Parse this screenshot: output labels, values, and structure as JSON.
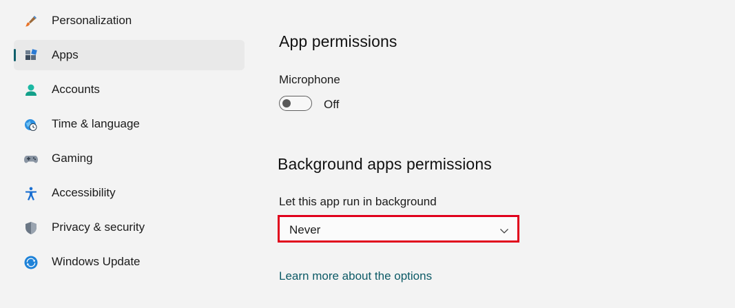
{
  "sidebar": {
    "items": [
      {
        "label": "Personalization",
        "icon": "paintbrush-icon"
      },
      {
        "label": "Apps",
        "icon": "apps-icon",
        "selected": true
      },
      {
        "label": "Accounts",
        "icon": "person-icon"
      },
      {
        "label": "Time & language",
        "icon": "globe-clock-icon"
      },
      {
        "label": "Gaming",
        "icon": "gamepad-icon"
      },
      {
        "label": "Accessibility",
        "icon": "accessibility-icon"
      },
      {
        "label": "Privacy & security",
        "icon": "shield-icon"
      },
      {
        "label": "Windows Update",
        "icon": "update-icon"
      }
    ]
  },
  "main": {
    "app_permissions": {
      "title": "App permissions",
      "microphone_label": "Microphone",
      "toggle_state": "Off"
    },
    "background_permissions": {
      "title": "Background apps permissions",
      "run_label": "Let this app run in background",
      "selected_option": "Never"
    },
    "learn_more": "Learn more about the options"
  },
  "colors": {
    "background": "#f3f3f3",
    "selected_nav": "#e9e9e9",
    "accent": "#0f5f6b",
    "link": "#0c5a66",
    "highlight_border": "#e0001b"
  }
}
